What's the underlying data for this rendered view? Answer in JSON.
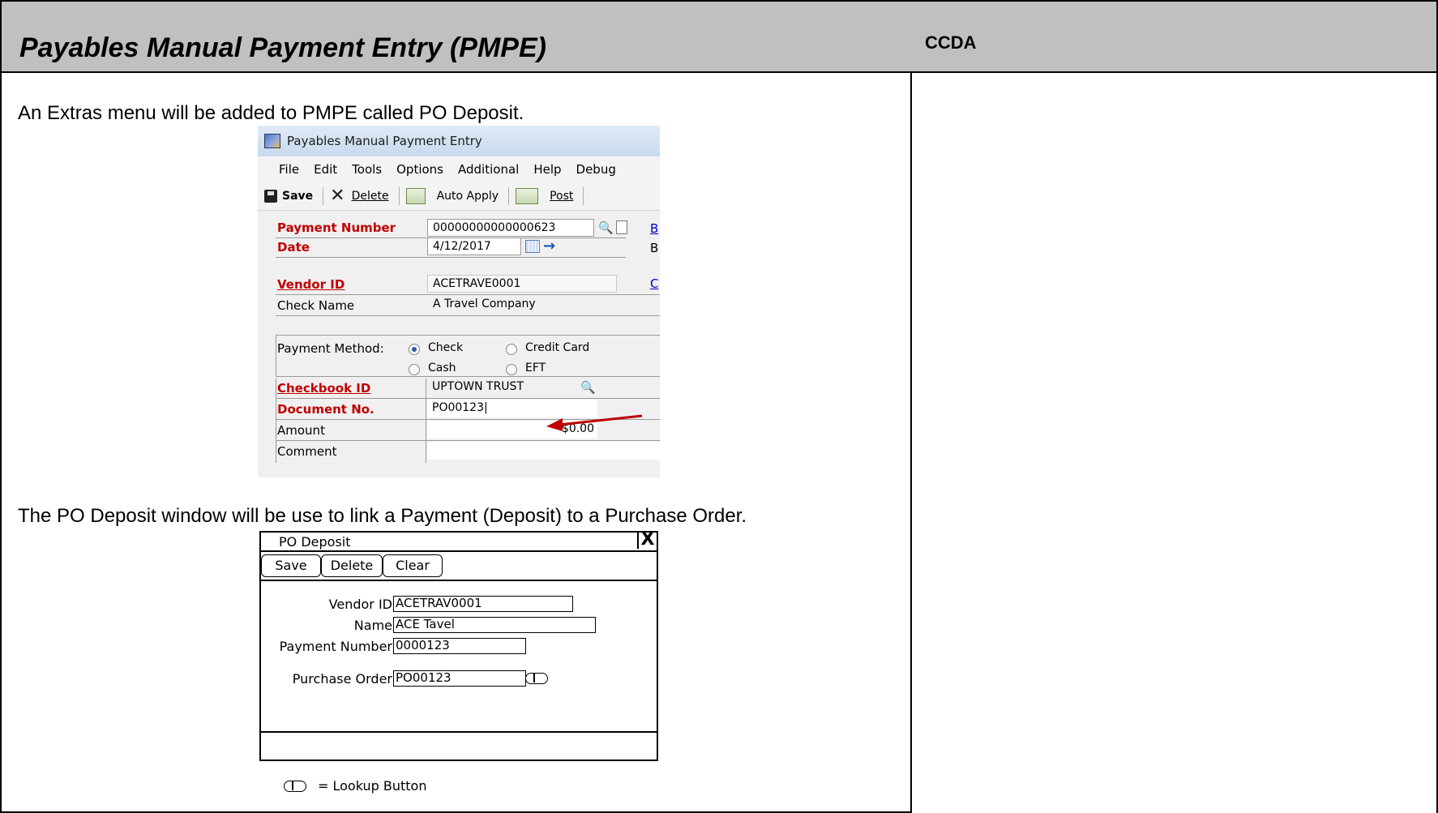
{
  "header": {
    "title": "Payables Manual Payment Entry (PMPE)",
    "right_title": "CCDA"
  },
  "paragraphs": {
    "p1": "An Extras menu will be added to PMPE called PO Deposit.",
    "p2": "The PO Deposit window will be use to link a Payment (Deposit) to a Purchase Order."
  },
  "gp_window": {
    "title": "Payables Manual Payment Entry",
    "menu": [
      "File",
      "Edit",
      "Tools",
      "Options",
      "Additional",
      "Help",
      "Debug"
    ],
    "toolbar": {
      "save": "Save",
      "delete": "Delete",
      "auto_apply": "Auto Apply",
      "post": "Post"
    },
    "fields": {
      "payment_number_label": "Payment Number",
      "payment_number": "00000000000000623",
      "date_label": "Date",
      "date": "4/12/2017",
      "vendor_id_label": "Vendor ID",
      "vendor_id": "ACETRAVE0001",
      "check_name_label": "Check Name",
      "check_name": "A Travel Company",
      "payment_method_label": "Payment Method:",
      "methods": [
        "Check",
        "Credit Card",
        "Cash",
        "EFT"
      ],
      "selected_method": "Check",
      "checkbook_id_label": "Checkbook ID",
      "checkbook_id": "UPTOWN TRUST",
      "document_no_label": "Document No.",
      "document_no": "PO00123|",
      "amount_label": "Amount",
      "amount": "$0.00",
      "comment_label": "Comment"
    },
    "side_links": [
      "B",
      "B",
      "C"
    ],
    "arrow_color": "#c00000"
  },
  "po_deposit": {
    "title": "PO Deposit",
    "close": "X",
    "buttons": [
      "Save",
      "Delete",
      "Clear"
    ],
    "vendor_id_label": "Vendor ID",
    "vendor_id": "ACETRAV0001",
    "name_label": "Name",
    "name": "ACE Tavel",
    "payment_number_label": "Payment Number",
    "payment_number": "0000123",
    "purchase_order_label": "Purchase Order",
    "purchase_order": "PO00123"
  },
  "legend": "= Lookup Button"
}
